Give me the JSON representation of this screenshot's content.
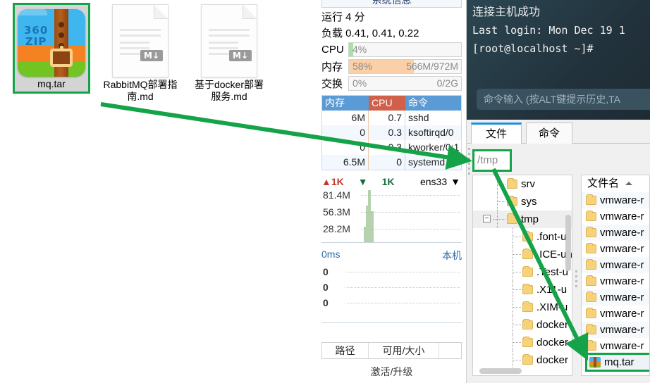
{
  "desktop": {
    "icons": [
      {
        "name": "mq.tar",
        "label": "mq.tar",
        "type": "archive",
        "brand": "360",
        "brand_sub": "ZIP",
        "selected": true
      },
      {
        "name": "rabbitmq",
        "label": "RabbitMQ部署指南.md",
        "type": "markdown",
        "badge": "M↓",
        "selected": false
      },
      {
        "name": "docker",
        "label": "基于docker部署服务.md",
        "type": "markdown",
        "badge": "M↓",
        "selected": false
      }
    ]
  },
  "sysmon": {
    "sysinfo_button": "系统信息",
    "uptime": "运行 4 分",
    "load": "负载 0.41, 0.41, 0.22",
    "meters": [
      {
        "label": "CPU",
        "pct": "4%",
        "amount": "",
        "fill_pct": 4,
        "color": "#a8e0a8"
      },
      {
        "label": "内存",
        "pct": "58%",
        "amount": "566M/972M",
        "fill_pct": 58,
        "color": "#fbd0a8"
      },
      {
        "label": "交换",
        "pct": "0%",
        "amount": "0/2G",
        "fill_pct": 0,
        "color": "#cfe8f7"
      }
    ],
    "process_table": {
      "headers": [
        "内存",
        "CPU",
        "命令"
      ],
      "rows": [
        {
          "mem": "6M",
          "cpu": "0.7",
          "cmd": "sshd"
        },
        {
          "mem": "0",
          "cpu": "0.3",
          "cmd": "ksoftirqd/0"
        },
        {
          "mem": "0",
          "cpu": "0.3",
          "cmd": "kworker/0:1"
        },
        {
          "mem": "6.5M",
          "cpu": "0",
          "cmd": "systemd"
        }
      ]
    },
    "network": {
      "upload": "1K",
      "download": "1K",
      "interface": "ens33",
      "y_labels": [
        "81.4M",
        "56.3M",
        "28.2M"
      ]
    },
    "latency": {
      "unit": "0ms",
      "scope": "本机",
      "y_labels": [
        "0",
        "0",
        "0"
      ]
    },
    "path_table": {
      "headers": [
        "路径",
        "可用/大小",
        ""
      ]
    },
    "activate": "激活/升级"
  },
  "terminal": {
    "connect_msg": "连接主机成功",
    "login_line": "Last login: Mon Dec 19 1",
    "prompt": "[root@localhost ~]#",
    "command_placeholder": "命令输入 (按ALT键提示历史,TA"
  },
  "filepane": {
    "tabs": [
      {
        "label": "文件",
        "active": true
      },
      {
        "label": "命令",
        "active": false
      }
    ],
    "path_value": "/tmp",
    "tree": [
      {
        "label": "srv",
        "depth": 1,
        "selected": false,
        "expandable": false
      },
      {
        "label": "sys",
        "depth": 1,
        "selected": false,
        "expandable": false
      },
      {
        "label": "tmp",
        "depth": 1,
        "selected": true,
        "expandable": true,
        "expander": "−"
      },
      {
        "label": ".font-u",
        "depth": 2,
        "selected": false,
        "expandable": false
      },
      {
        "label": ".ICE-un",
        "depth": 2,
        "selected": false,
        "expandable": false
      },
      {
        "label": ".Test-u",
        "depth": 2,
        "selected": false,
        "expandable": false
      },
      {
        "label": ".X11-u",
        "depth": 2,
        "selected": false,
        "expandable": false
      },
      {
        "label": ".XIM-u",
        "depth": 2,
        "selected": false,
        "expandable": false
      },
      {
        "label": "docker",
        "depth": 2,
        "selected": false,
        "expandable": false
      },
      {
        "label": "docker",
        "depth": 2,
        "selected": false,
        "expandable": false
      },
      {
        "label": "docker",
        "depth": 2,
        "selected": false,
        "expandable": false
      }
    ],
    "list_header": "文件名",
    "list_sort": "ascending",
    "files": [
      {
        "label": "vmware-r",
        "type": "folder"
      },
      {
        "label": "vmware-r",
        "type": "folder"
      },
      {
        "label": "vmware-r",
        "type": "folder"
      },
      {
        "label": "vmware-r",
        "type": "folder"
      },
      {
        "label": "vmware-r",
        "type": "folder"
      },
      {
        "label": "vmware-r",
        "type": "folder"
      },
      {
        "label": "vmware-r",
        "type": "folder"
      },
      {
        "label": "vmware-r",
        "type": "folder"
      },
      {
        "label": "vmware-r",
        "type": "folder"
      },
      {
        "label": "vmware-r",
        "type": "folder"
      },
      {
        "label": "vmware-r",
        "type": "folder"
      }
    ],
    "highlighted_file": {
      "label": "mq.tar",
      "type": "archive"
    }
  },
  "annotations": {
    "color": "#15a349",
    "arrows": [
      {
        "name": "drag-mqtar-to-path",
        "from": [
          143,
          148
        ],
        "to": [
          660,
          228
        ]
      },
      {
        "name": "drag-path-to-filelist",
        "from": [
          700,
          240
        ],
        "to": [
          830,
          502
        ]
      }
    ]
  }
}
